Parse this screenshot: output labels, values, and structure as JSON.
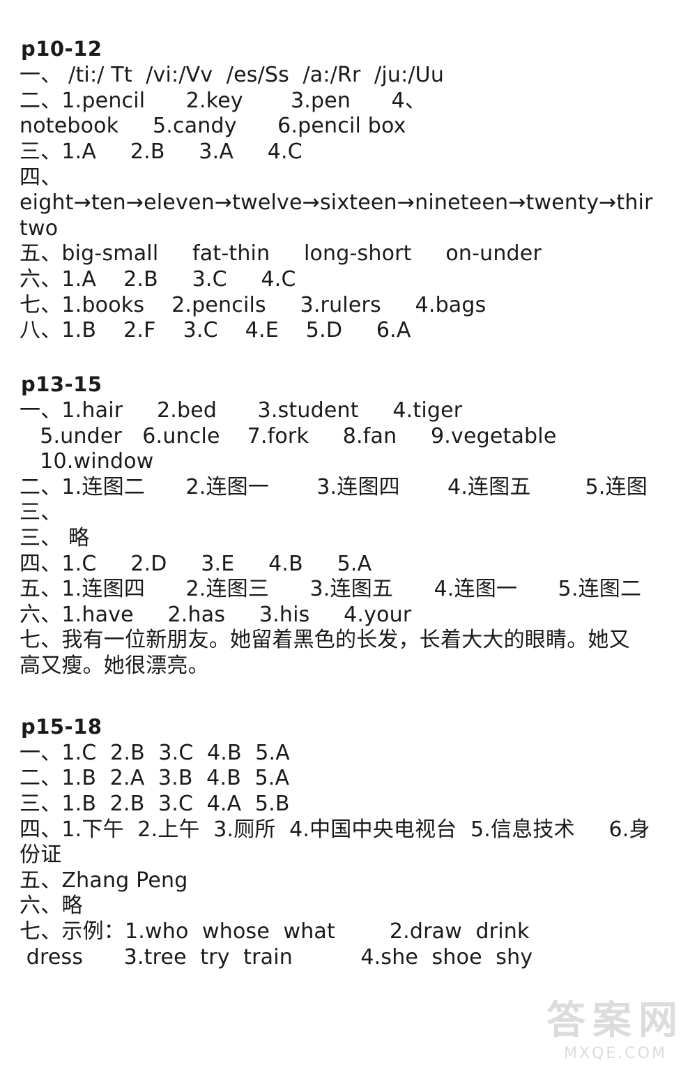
{
  "document": {
    "sections": [
      {
        "title": "p10-12",
        "lines": [
          "一、 /ti:/ Tt  /vi:/Vv  /es/Ss  /a:/Rr  /ju:/Uu",
          "二、1.pencil      2.key       3.pen      4、",
          "notebook     5.candy      6.pencil box",
          "三、1.A     2.B     3.A     4.C",
          "四、",
          "eight→ten→eleven→twelve→sixteen→nineteen→twenty→thir",
          "two",
          "五、big-small     fat-thin     long-short     on-under",
          "六、1.A    2.B     3.C     4.C",
          "七、1.books    2.pencils     3.rulers     4.bags",
          "八、1.B    2.F    3.C    4.E    5.D     6.A"
        ]
      },
      {
        "title": "p13-15",
        "lines": [
          "一、1.hair     2.bed      3.student     4.tiger",
          "   5.under   6.uncle    7.fork     8.fan     9.vegetable",
          "   10.window",
          "二、1.连图二      2.连图一       3.连图四       4.连图五        5.连图",
          "三、",
          "三、 略",
          "四、1.C     2.D     3.E     4.B     5.A",
          "五、1.连图四      2.连图三      3.连图五      4.连图一      5.连图二",
          "六、1.have     2.has     3.his     4.your",
          "七、我有一位新朋友。她留着黑色的长发，长着大大的眼睛。她又",
          "高又瘦。她很漂亮。"
        ]
      },
      {
        "title": "p15-18",
        "lines": [
          "一、1.C  2.B  3.C  4.B  5.A",
          "二、1.B  2.A  3.B  4.B  5.A",
          "三、1.B  2.B  3.C  4.A  5.B",
          "四、1.下午  2.上午  3.厕所  4.中国中央电视台  5.信息技术     6.身",
          "份证",
          "五、Zhang Peng",
          "六、略",
          "七、示例：1.who  whose  what        2.draw  drink",
          " dress      3.tree  try  train          4.she  shoe  shy"
        ]
      }
    ]
  },
  "watermark": {
    "big": "答案网",
    "small": "MXQE.COM"
  }
}
